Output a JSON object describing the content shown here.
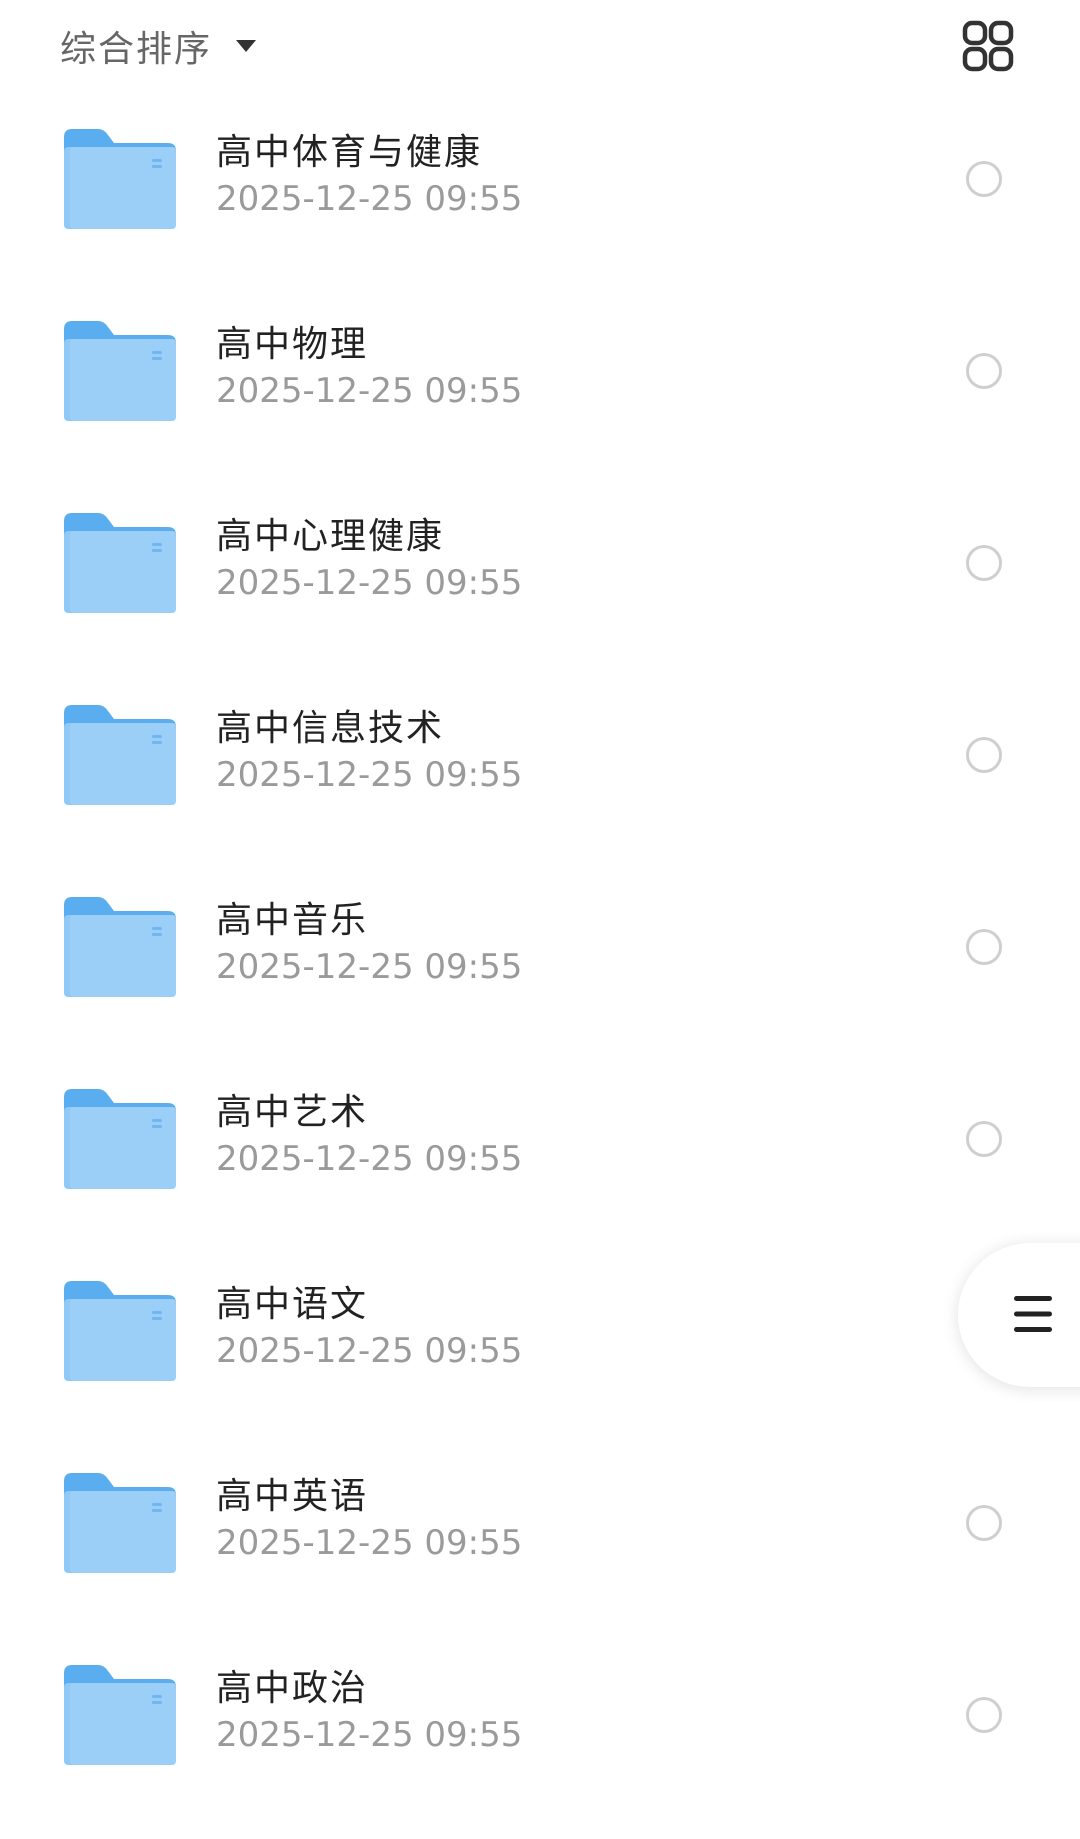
{
  "header": {
    "sort_label": "综合排序",
    "sort_caret_icon": "caret-down-icon",
    "view_toggle_icon": "grid-view-icon"
  },
  "colors": {
    "folder_body": "#8ec9f7",
    "folder_tab": "#5aaef0",
    "title_text": "#222222",
    "date_text": "#9a9a9a",
    "radio_border": "#cfcfcf"
  },
  "folders": [
    {
      "name": "高中体育与健康",
      "date": "2025-12-25 09:55"
    },
    {
      "name": "高中物理",
      "date": "2025-12-25 09:55"
    },
    {
      "name": "高中心理健康",
      "date": "2025-12-25 09:55"
    },
    {
      "name": "高中信息技术",
      "date": "2025-12-25 09:55"
    },
    {
      "name": "高中音乐",
      "date": "2025-12-25 09:55"
    },
    {
      "name": "高中艺术",
      "date": "2025-12-25 09:55"
    },
    {
      "name": "高中语文",
      "date": "2025-12-25 09:55"
    },
    {
      "name": "高中英语",
      "date": "2025-12-25 09:55"
    },
    {
      "name": "高中政治",
      "date": "2025-12-25 09:55"
    }
  ],
  "floating_menu": {
    "icon": "menu-icon"
  }
}
